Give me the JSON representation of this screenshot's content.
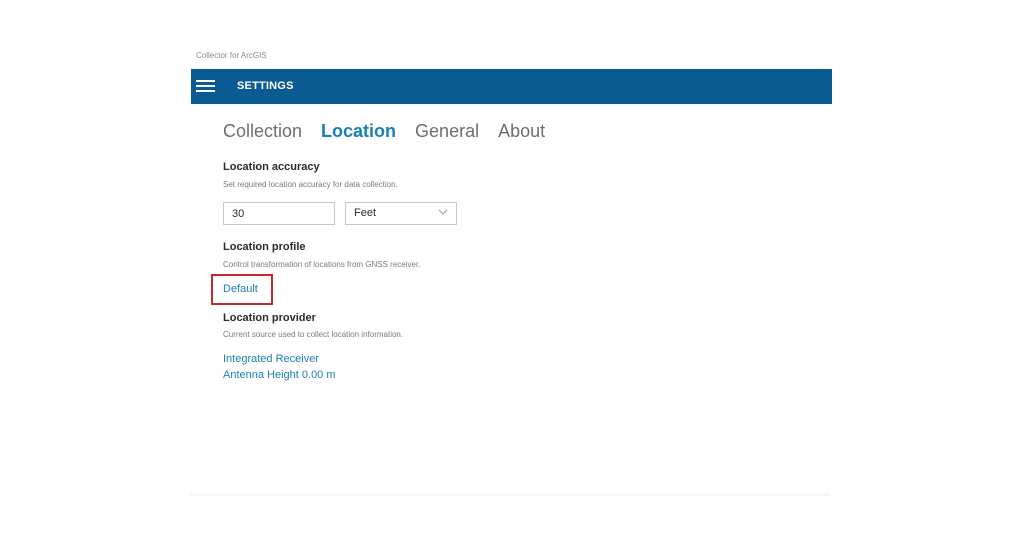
{
  "app": {
    "title": "Collector for ArcGIS"
  },
  "header": {
    "menu_icon": "hamburger-menu-icon",
    "title": "SETTINGS",
    "background_color": "#0b5b93"
  },
  "tabs": [
    {
      "label": "Collection",
      "active": false
    },
    {
      "label": "Location",
      "active": true
    },
    {
      "label": "General",
      "active": false
    },
    {
      "label": "About",
      "active": false
    }
  ],
  "location_accuracy": {
    "title": "Location accuracy",
    "description": "Set required location accuracy for data collection.",
    "value": "30",
    "unit_selected": "Feet",
    "unit_icon": "chevron-down-icon"
  },
  "location_profile": {
    "title": "Location profile",
    "description": "Control transformation of locations from GNSS receiver.",
    "value": "Default",
    "highlight_color": "#c8262c"
  },
  "location_provider": {
    "title": "Location provider",
    "description": "Current source used to collect location information.",
    "receiver": "Integrated Receiver",
    "antenna_height": "Antenna Height 0.00 m"
  },
  "colors": {
    "accent": "#1a7fb3",
    "text": "#2b2b2b",
    "muted": "#7a7a7a"
  }
}
